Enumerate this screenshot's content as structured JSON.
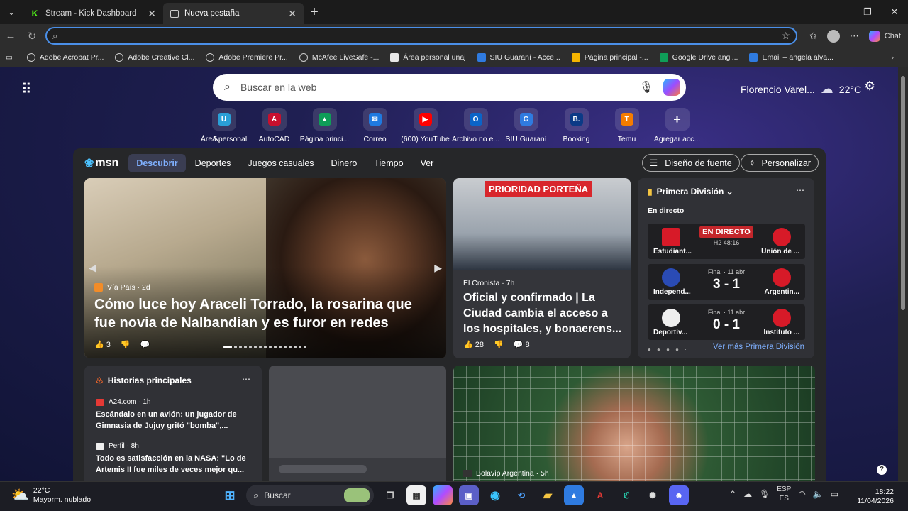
{
  "tabs": [
    {
      "title": "Stream - Kick Dashboard",
      "active": false
    },
    {
      "title": "Nueva pestaña",
      "active": true
    }
  ],
  "addressbar": {
    "value": "",
    "chat_label": "Chat"
  },
  "bookmarks": [
    {
      "label": "Adobe Acrobat Pr...",
      "color": "#cfcfcf"
    },
    {
      "label": "Adobe Creative Cl...",
      "color": "#cfcfcf"
    },
    {
      "label": "Adobe Premiere Pr...",
      "color": "#cfcfcf"
    },
    {
      "label": "McAfee LiveSafe -...",
      "color": "#cfcfcf"
    },
    {
      "label": "Área personal unaj",
      "color": "#e8e8e8"
    },
    {
      "label": "SIU Guaraní - Acce...",
      "color": "#2f7be0"
    },
    {
      "label": "Página principal -...",
      "color": "#f4b400"
    },
    {
      "label": "Google Drive angi...",
      "color": "#0f9d58"
    },
    {
      "label": "Email – angela alva...",
      "color": "#2f7be0"
    }
  ],
  "search": {
    "placeholder": "Buscar en la web"
  },
  "weather": {
    "location": "Florencio Varel...",
    "temp": "22°C"
  },
  "quicklinks": [
    {
      "label": "Área personal",
      "glyph": "U",
      "color": "#2a9fd6"
    },
    {
      "label": "AutoCAD",
      "glyph": "A",
      "color": "#c8102e"
    },
    {
      "label": "Página princi...",
      "glyph": "▲",
      "color": "#0f9d58"
    },
    {
      "label": "Correo",
      "glyph": "✉",
      "color": "#1f7ae0"
    },
    {
      "label": "(600) YouTube",
      "glyph": "▶",
      "color": "#ff0000"
    },
    {
      "label": "Archivo no e...",
      "glyph": "O",
      "color": "#0a64c8"
    },
    {
      "label": "SIU Guaraní",
      "glyph": "G",
      "color": "#2f7be0"
    },
    {
      "label": "Booking",
      "glyph": "B.",
      "color": "#0b3a86"
    },
    {
      "label": "Temu",
      "glyph": "T",
      "color": "#f57c00"
    },
    {
      "label": "Agregar acc...",
      "glyph": "+",
      "color": "transparent"
    }
  ],
  "msn": {
    "logo": "msn",
    "tabs": [
      "Descubrir",
      "Deportes",
      "Juegos casuales",
      "Dinero",
      "Tiempo",
      "Ver"
    ],
    "font_button": "Diseño de fuente",
    "personalize_button": "Personalizar"
  },
  "hero": {
    "source": "Vía País · 2d",
    "headline": "Cómo luce hoy Araceli Torrado, la rosarina que fue novia de Nalbandian y es furor en redes",
    "likes": "3"
  },
  "card2": {
    "tag": "PRIORIDAD PORTEÑA",
    "source": "El Cronista · 7h",
    "headline": "Oficial y confirmado | La Ciudad cambia el acceso a los hospitales, y bonaerens...",
    "likes": "28",
    "comments": "8"
  },
  "sports": {
    "title": "Primera División",
    "live_label": "En directo",
    "matches": [
      {
        "home": "Estudiant...",
        "away": "Unión de ...",
        "status": "EN DIRECTO",
        "detail": "H2 48:16",
        "score": ""
      },
      {
        "home": "Independ...",
        "away": "Argentin...",
        "status": "",
        "detail": "Final · 11 abr",
        "score": "3 - 1"
      },
      {
        "home": "Deportiv...",
        "away": "Instituto ...",
        "status": "",
        "detail": "Final · 11 abr",
        "score": "0 - 1"
      }
    ],
    "footer": "Ver más Primera División"
  },
  "top_stories": {
    "title": "Historias principales",
    "items": [
      {
        "source": "A24.com · 1h",
        "headline": "Escándalo en un avión: un jugador de Gimnasia de Jujuy gritó \"bomba\",..."
      },
      {
        "source": "Perfil · 8h",
        "headline": "Todo es satisfacción en la NASA: \"Lo de Artemis II fue miles de veces mejor qu..."
      }
    ]
  },
  "big_card": {
    "source": "Bolavip Argentina · 5h"
  },
  "taskbar": {
    "weather_temp": "22°C",
    "weather_desc": "Mayorm. nublado",
    "search_placeholder": "Buscar",
    "lang_top": "ESP",
    "lang_bottom": "ES",
    "time": "18:22",
    "date": "11/04/2026"
  }
}
